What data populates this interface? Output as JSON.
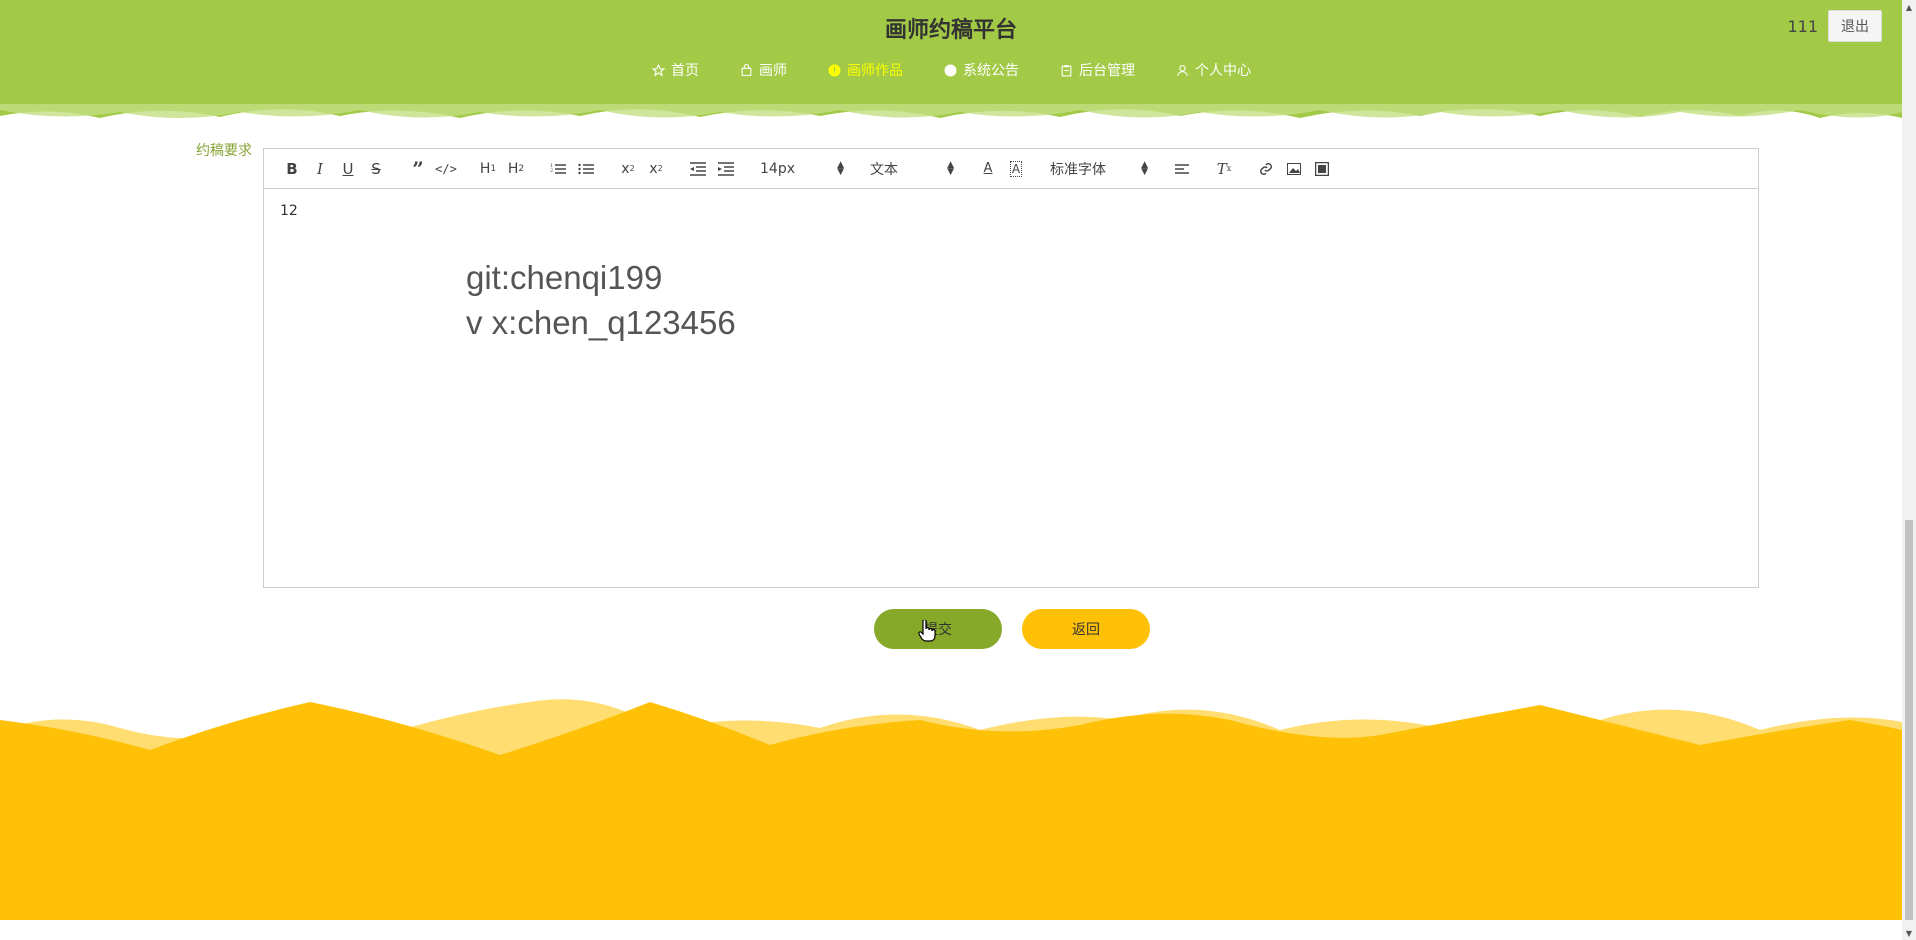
{
  "header": {
    "site_title": "画师约稿平台",
    "username": "111",
    "logout_label": "退出",
    "background_color": "#a2ca46",
    "nav": [
      {
        "label": "首页",
        "icon": "star-icon",
        "active": false
      },
      {
        "label": "画师",
        "icon": "bag-icon",
        "active": false
      },
      {
        "label": "画师作品",
        "icon": "info-circle-icon",
        "active": true
      },
      {
        "label": "系统公告",
        "icon": "circle-icon",
        "active": false
      },
      {
        "label": "后台管理",
        "icon": "clipboard-icon",
        "active": false
      },
      {
        "label": "个人中心",
        "icon": "user-icon",
        "active": false
      }
    ]
  },
  "form": {
    "requirement_label": "约稿要求",
    "editor": {
      "toolbar": {
        "font_size": "14px",
        "header_format": "文本",
        "font_family": "标准字体"
      },
      "content": {
        "first_line": "12",
        "watermark_line1": "git:chenqi199",
        "watermark_line2": "v x:chen_q123456"
      }
    },
    "submit_label": "提交",
    "back_label": "返回",
    "submit_color": "#86a92a",
    "back_color": "#ffc107"
  },
  "footer": {
    "color": "#ffc107"
  }
}
